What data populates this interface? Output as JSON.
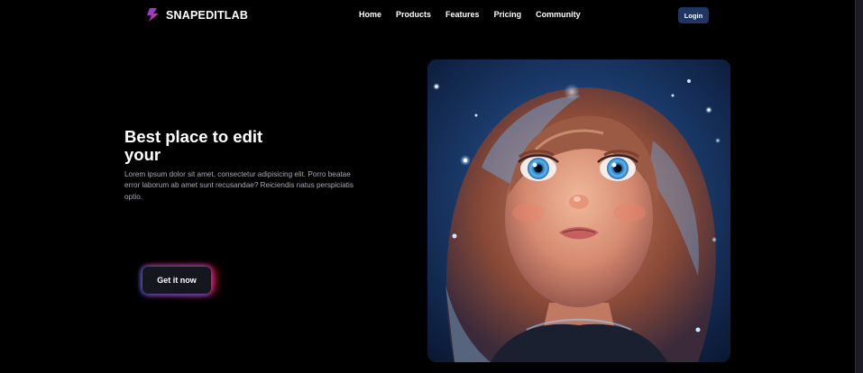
{
  "brand": {
    "name": "SNAPEDITLAB",
    "logo_icon": "lightning-logo-icon",
    "logo_colors": [
      "#7b3cf0",
      "#e0357e"
    ]
  },
  "nav": {
    "links": [
      "Home",
      "Products",
      "Features",
      "Pricing",
      "Community"
    ],
    "login_label": "Login"
  },
  "hero": {
    "title": "Best place to edit your",
    "description": "Lorem ipsum dolor sit amet, consectetur adipisicing elit. Porro beatae error laborum ab amet sunt recusandae? Reiciendis natus perspiciatis optio.",
    "cta_label": "Get it now",
    "image_subject": "illustrated-girl-portrait"
  },
  "colors": {
    "background": "#000000",
    "login_button": "#1f3663",
    "cta_glow_left": "#466eff",
    "cta_glow_right": "#ff2850",
    "description_text": "#a9a9b4"
  }
}
